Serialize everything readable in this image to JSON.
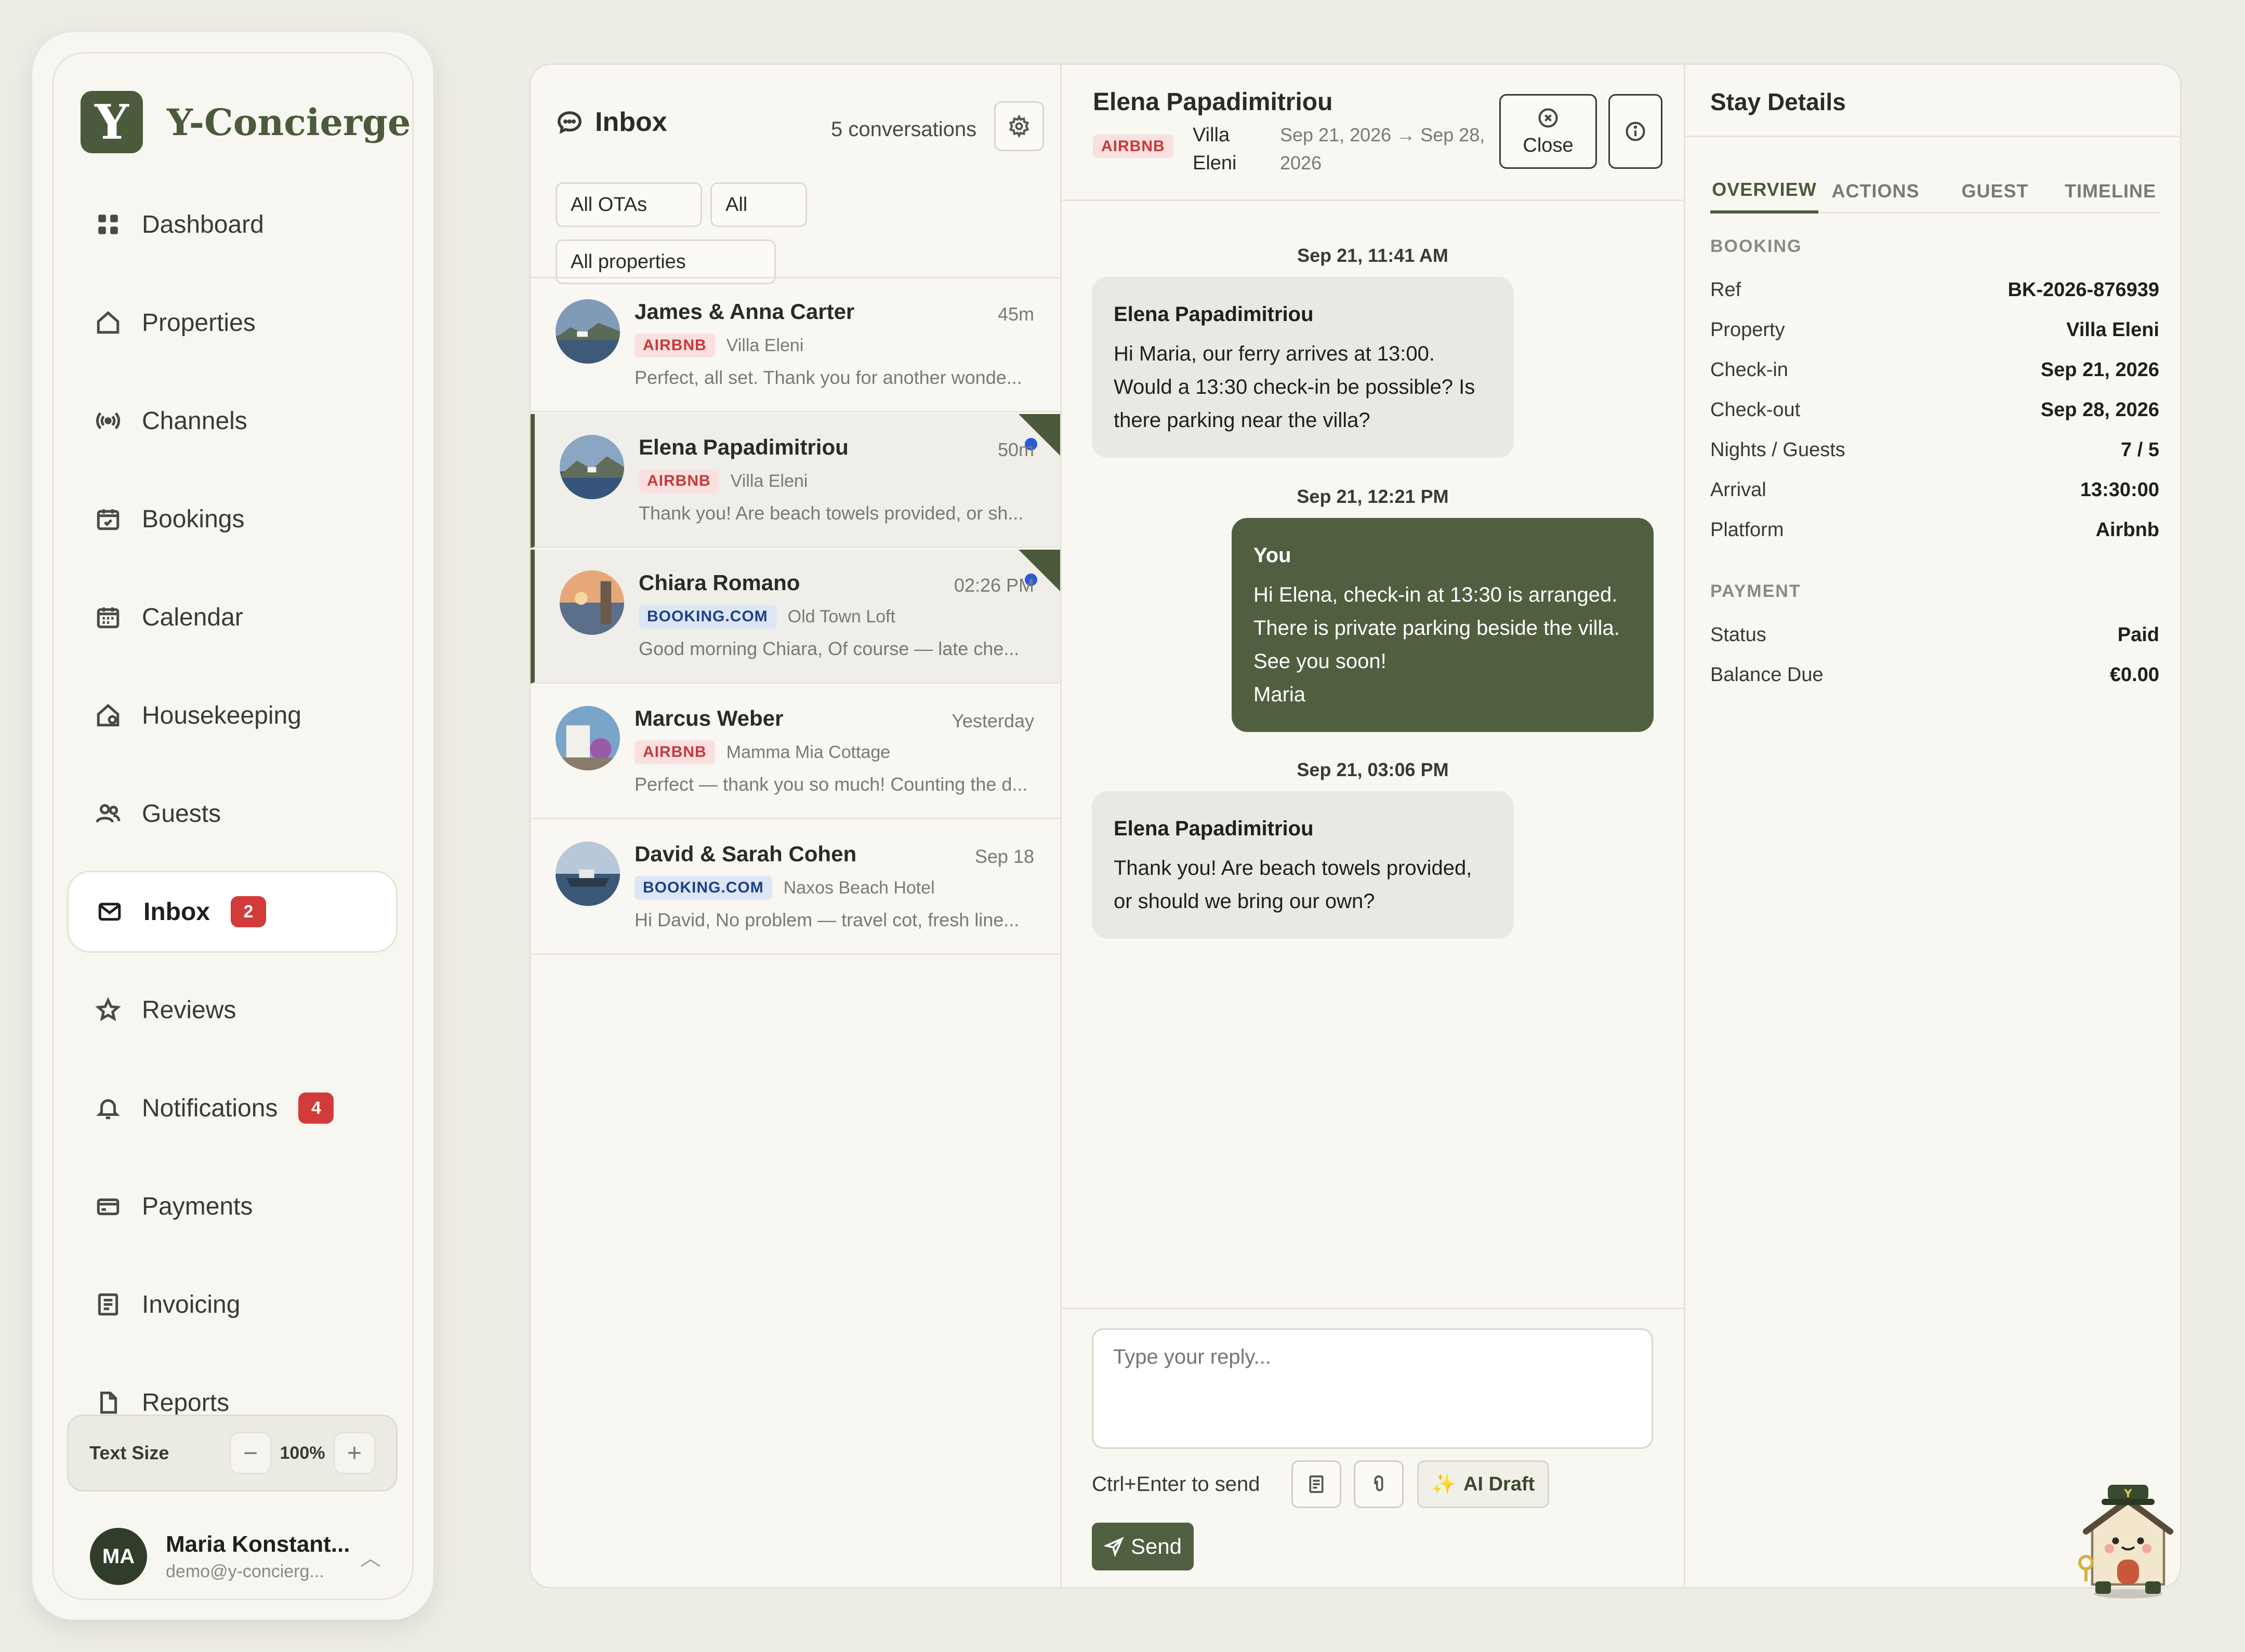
{
  "app": {
    "brand_initial": "Y",
    "brand_name": "Y-Concierge"
  },
  "sidebar": {
    "items": [
      {
        "label": "Dashboard",
        "icon": "grid-icon"
      },
      {
        "label": "Properties",
        "icon": "house-icon"
      },
      {
        "label": "Channels",
        "icon": "broadcast-icon"
      },
      {
        "label": "Bookings",
        "icon": "calendar-check-icon"
      },
      {
        "label": "Calendar",
        "icon": "calendar-icon"
      },
      {
        "label": "Housekeeping",
        "icon": "house-clean-icon"
      },
      {
        "label": "Guests",
        "icon": "users-icon"
      },
      {
        "label": "Inbox",
        "icon": "mail-icon",
        "badge": "2",
        "active": true
      },
      {
        "label": "Reviews",
        "icon": "star-icon"
      },
      {
        "label": "Notifications",
        "icon": "bell-icon",
        "badge": "4"
      },
      {
        "label": "Payments",
        "icon": "card-icon"
      },
      {
        "label": "Invoicing",
        "icon": "invoice-icon"
      },
      {
        "label": "Reports",
        "icon": "report-icon"
      }
    ],
    "text_size": {
      "label": "Text Size",
      "value": "100%",
      "minus": "−",
      "plus": "+"
    },
    "user": {
      "initials": "MA",
      "name": "Maria Konstant...",
      "email": "demo@y-concierg..."
    }
  },
  "inbox": {
    "title": "Inbox",
    "count": "5 conversations",
    "filters": {
      "ota": "All OTAs",
      "status": "All",
      "property": "All properties"
    },
    "conversations": [
      {
        "name": "James & Anna Carter",
        "time": "45m",
        "ota": "AIRBNB",
        "property": "Villa Eleni",
        "preview": "Perfect, all set. Thank you for another wonde...",
        "unread": false
      },
      {
        "name": "Elena Papadimitriou",
        "time": "50m",
        "ota": "AIRBNB",
        "property": "Villa Eleni",
        "preview": "Thank you! Are beach towels provided, or sh...",
        "unread": true
      },
      {
        "name": "Chiara Romano",
        "time": "02:26 PM",
        "ota": "BOOKING.COM",
        "property": "Old Town Loft",
        "preview": "Good morning Chiara, Of course — late che...",
        "unread": true
      },
      {
        "name": "Marcus Weber",
        "time": "Yesterday",
        "ota": "AIRBNB",
        "property": "Mamma Mia Cottage",
        "preview": "Perfect — thank you so much! Counting the d...",
        "unread": false
      },
      {
        "name": "David & Sarah Cohen",
        "time": "Sep 18",
        "ota": "BOOKING.COM",
        "property": "Naxos Beach Hotel",
        "preview": "Hi David, No problem — travel cot, fresh line...",
        "unread": false
      }
    ]
  },
  "chat": {
    "guest_name": "Elena Papadimitriou",
    "ota": "AIRBNB",
    "property": "Villa Eleni",
    "dates": "Sep 21, 2026 → Sep 28, 2026",
    "close_label": "Close",
    "messages": [
      {
        "time": "Sep 21, 11:41 AM",
        "sender": "Elena Papadimitriou",
        "text": "Hi Maria, our ferry arrives at 13:00. Would a 13:30 check-in be possible? Is there parking near the villa?",
        "direction": "in"
      },
      {
        "time": "Sep 21, 12:21 PM",
        "sender": "You",
        "text": "Hi Elena, check-in at 13:30 is arranged. There is private parking beside the villa. See you soon!",
        "signature": "Maria",
        "direction": "out"
      },
      {
        "time": "Sep 21, 03:06 PM",
        "sender": "Elena Papadimitriou",
        "text": "Thank you! Are beach towels provided, or should we bring our own?",
        "direction": "in"
      }
    ],
    "reply_placeholder": "Type your reply...",
    "hint": "Ctrl+Enter to send",
    "ai_label": "AI Draft",
    "send_label": "Send"
  },
  "details": {
    "title": "Stay Details",
    "tabs": [
      "OVERVIEW",
      "ACTIONS",
      "GUEST",
      "TIMELINE"
    ],
    "booking_label": "BOOKING",
    "booking": [
      {
        "k": "Ref",
        "v": "BK-2026-876939"
      },
      {
        "k": "Property",
        "v": "Villa Eleni"
      },
      {
        "k": "Check-in",
        "v": "Sep 21, 2026"
      },
      {
        "k": "Check-out",
        "v": "Sep 28, 2026"
      },
      {
        "k": "Nights / Guests",
        "v": "7 / 5"
      },
      {
        "k": "Arrival",
        "v": "13:30:00"
      },
      {
        "k": "Platform",
        "v": "Airbnb"
      }
    ],
    "payment_label": "PAYMENT",
    "payment": [
      {
        "k": "Status",
        "v": "Paid"
      },
      {
        "k": "Balance Due",
        "v": "€0.00"
      }
    ]
  },
  "colors": {
    "accent": "#4a5a3a",
    "badge_red": "#d33a3a",
    "unread_blue": "#2a5bd7"
  }
}
